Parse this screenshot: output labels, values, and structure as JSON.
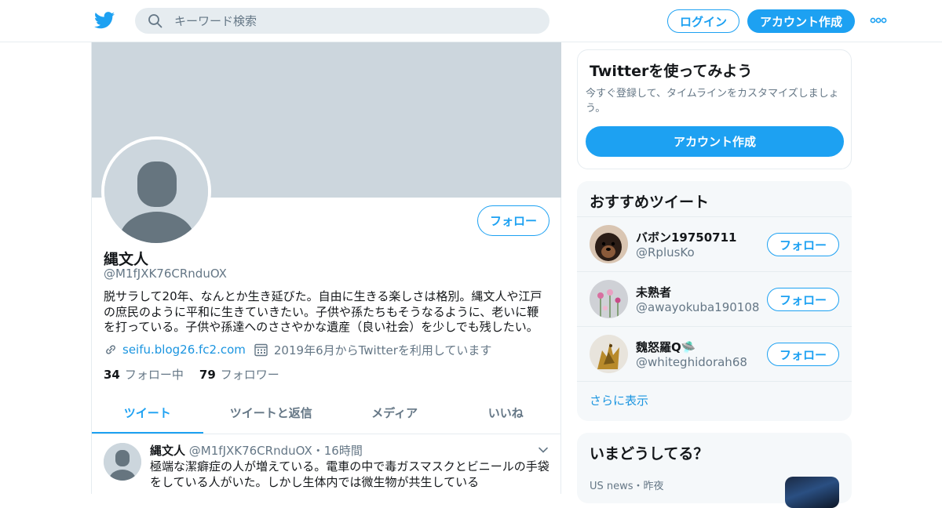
{
  "header": {
    "search_placeholder": "キーワード検索",
    "login_label": "ログイン",
    "signup_label": "アカウント作成"
  },
  "profile": {
    "name": "縄文人",
    "handle": "@M1fJXK76CRnduOX",
    "bio": "脱サラして20年、なんとか生き延びた。自由に生きる楽しさは格別。縄文人や江戸の庶民のように平和に生きていきたい。子供や孫たちもそうなるように、老いに鞭を打っている。子供や孫達へのささやかな遺産（良い社会）を少しでも残したい。",
    "website": "seifu.blog26.fc2.com",
    "joined": "2019年6月からTwitterを利用しています",
    "following_count": "34",
    "following_label": "フォロー中",
    "followers_count": "79",
    "followers_label": "フォロワー",
    "follow_label": "フォロー"
  },
  "tabs": [
    "ツイート",
    "ツイートと返信",
    "メディア",
    "いいね"
  ],
  "tweet": {
    "name": "縄文人",
    "handle": "@M1fJXK76CRnduOX",
    "separator": "・",
    "time": "16時間",
    "text": "極端な潔癖症の人が増えている。電車の中で毒ガスマスクとビニールの手袋をしている人がいた。しかし生体内では微生物が共生している"
  },
  "signup_card": {
    "title": "Twitterを使ってみよう",
    "description": "今すぐ登録して、タイムラインをカスタマイズしましょう。",
    "button": "アカウント作成"
  },
  "who_to_follow": {
    "title": "おすすめツイート",
    "follow_label": "フォロー",
    "show_more": "さらに表示",
    "users": [
      {
        "name": "バボン19750711",
        "handle": "@RplusKo"
      },
      {
        "name": "未熟者",
        "handle": "@awayokuba190108"
      },
      {
        "name": "魏怒羅Q🛸",
        "handle": "@whiteghidorah68"
      }
    ]
  },
  "trends": {
    "title": "いまどうしてる？",
    "item_category": "US news・昨夜"
  },
  "colors": {
    "accent": "#1da1f2",
    "banner": "#ccd6dd",
    "secondary_text": "#657786",
    "border": "#e6ecf0"
  }
}
